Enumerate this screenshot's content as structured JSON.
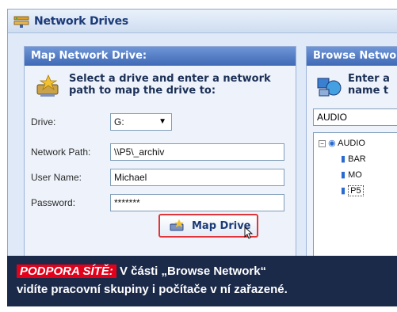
{
  "window": {
    "title": "Network Drives",
    "icon": "network-drives-icon"
  },
  "map_panel": {
    "header": "Map Network Drive:",
    "instruction_line1": "Select a drive and enter a network",
    "instruction_line2": "path to map the drive to:",
    "drive_label": "Drive:",
    "drive_value": "G:",
    "path_label": "Network Path:",
    "path_value": "\\\\P5\\_archiv",
    "user_label": "User Name:",
    "user_value": "Michael",
    "password_label": "Password:",
    "password_value": "*******",
    "map_button": "Map Drive"
  },
  "browse_panel": {
    "header": "Browse Networ",
    "instruction_line1": "Enter a",
    "instruction_line2": "name t",
    "search_value": "AUDIO",
    "tree": {
      "root": "AUDIO",
      "children": [
        "BAR",
        "MO",
        "P5"
      ]
    }
  },
  "caption": {
    "tag": "PODPORA SÍTĚ:",
    "text_line1": "V části „Browse Network“",
    "text_line2": "vidíte pracovní skupiny i počítače v ní zařazené."
  },
  "colors": {
    "accent": "#e2001a",
    "caption_bg": "#1c2a4a",
    "header_blue": "#3f69b6",
    "window_bg": "#dfe9f7"
  }
}
